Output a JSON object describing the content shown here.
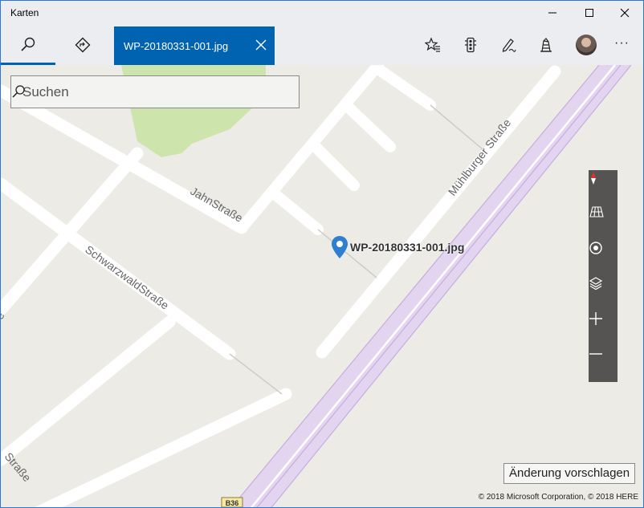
{
  "app": {
    "title": "Karten"
  },
  "window_controls": {
    "minimize_icon": "minimize-icon",
    "maximize_icon": "maximize-icon",
    "close_icon": "close-icon"
  },
  "toolbar": {
    "search_icon": "search-icon",
    "directions_icon": "directions-icon",
    "active_tab": {
      "label": "WP-20180331-001.jpg",
      "close_icon": "close-icon"
    },
    "right_icons": [
      "favorites-icon",
      "traffic-icon",
      "ink-icon",
      "3d-cities-icon",
      "avatar",
      "more-icon"
    ],
    "more_label": "···"
  },
  "search": {
    "placeholder": "Suchen",
    "value": ""
  },
  "map": {
    "streets": {
      "jahn": "JahnStraße",
      "muehlburger": "Mühlburger Straße",
      "schwarzwald": "SchwarzwaldStraße",
      "strasse_bottom": "Straße",
      "edge": "e",
      "road_sign": "B36"
    },
    "pin": {
      "label": "WP-20180331-001.jpg",
      "color": "#2f7fd1"
    },
    "controls": [
      "compass-icon",
      "tilt-icon",
      "location-icon",
      "layers-icon",
      "zoom-in-icon",
      "zoom-out-icon"
    ],
    "suggest_button": "Änderung vorschlagen",
    "copyright": "© 2018 Microsoft Corporation, © 2018 HERE"
  },
  "colors": {
    "accent": "#0063b1",
    "titlebar_bg": "#ecedf0",
    "map_bg": "#ecebe6",
    "park": "#cde4ad",
    "rail": "#e3d4f0"
  }
}
